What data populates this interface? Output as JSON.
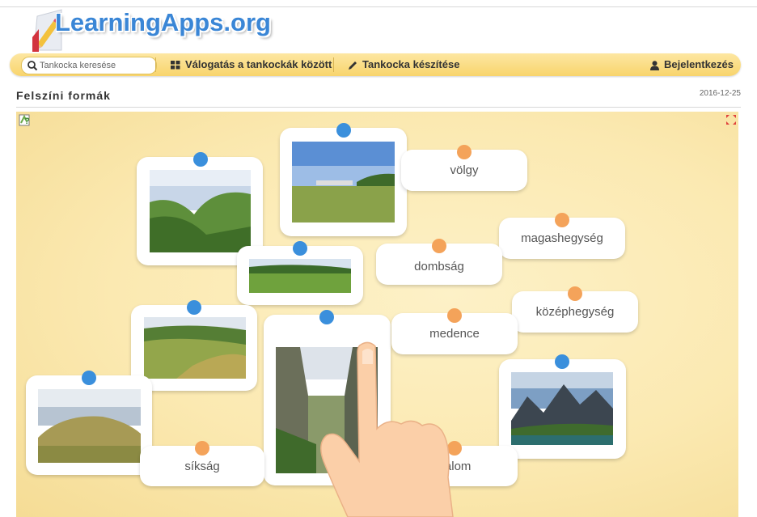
{
  "header": {
    "logo_text": "LearningApps.org"
  },
  "navbar": {
    "search_placeholder": "Tankocka keresése",
    "browse_label": "Válogatás a tankockák között",
    "create_label": "Tankocka készítése",
    "login_label": "Bejelentkezés"
  },
  "page": {
    "title": "Felszíni formák",
    "date": "2016-12-25"
  },
  "board": {
    "word_cards": [
      "völgy",
      "magashegység",
      "dombság",
      "középhegység",
      "medence",
      "síkság",
      "halom"
    ]
  },
  "colors": {
    "nav_bg": "#f8d46c",
    "logo_blue": "#3a86d6",
    "pin_blue": "#3a8fdc",
    "pin_orange": "#f4a35a",
    "board_bg": "#fbe9b1"
  }
}
